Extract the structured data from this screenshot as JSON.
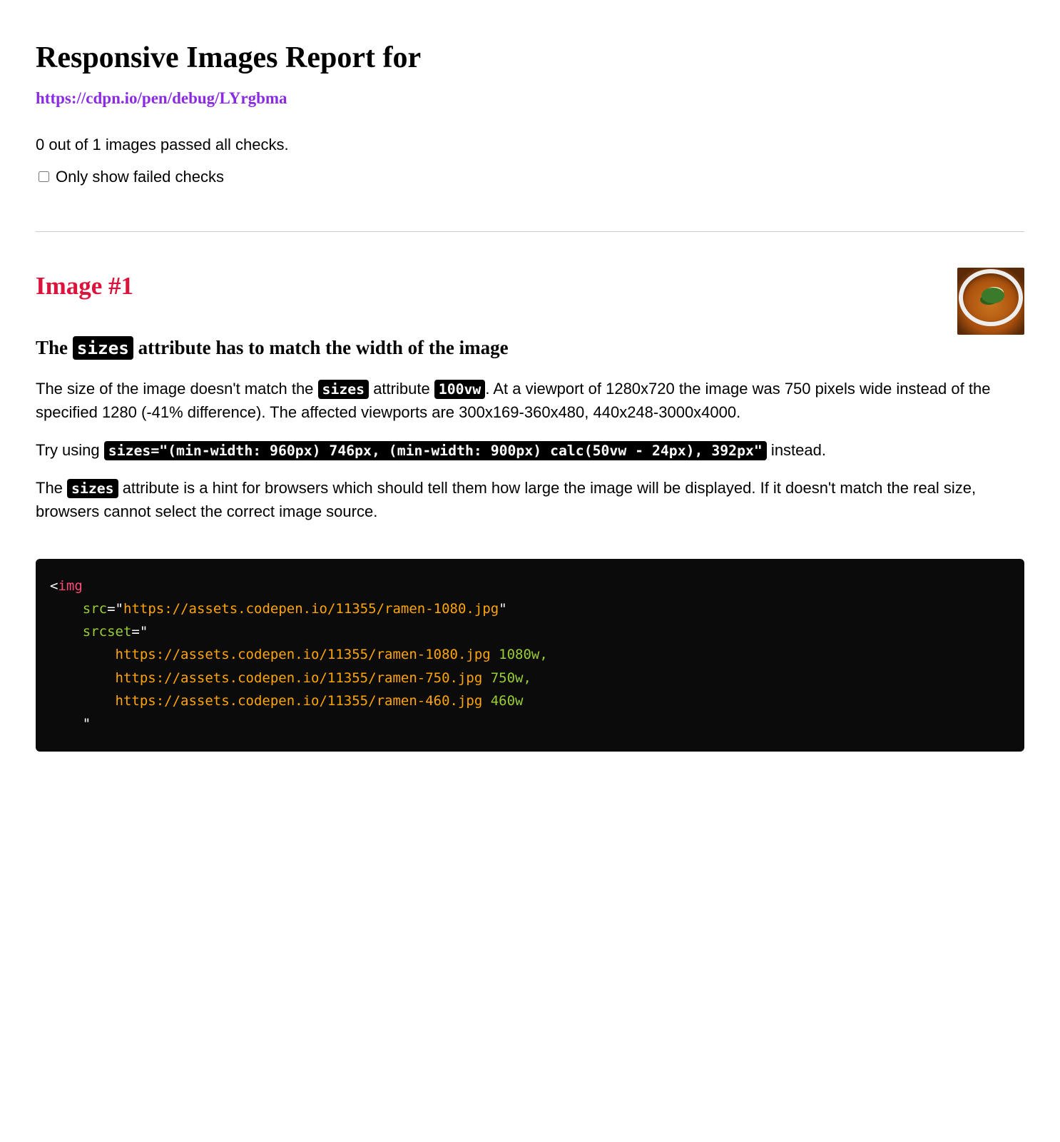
{
  "header": {
    "title": "Responsive Images Report for",
    "url": "https://cdpn.io/pen/debug/LYrgbma"
  },
  "summary": {
    "text": "0 out of 1 images passed all checks.",
    "filter_label": "Only show failed checks"
  },
  "image": {
    "heading": "Image #1",
    "check_heading_pre": "The ",
    "check_heading_code": "sizes",
    "check_heading_post": " attribute has to match the width of the image",
    "para1_a": "The size of the image doesn't match the ",
    "para1_code1": "sizes",
    "para1_b": " attribute ",
    "para1_code2": "100vw",
    "para1_c": ". At a viewport of 1280x720 the image was 750 pixels wide instead of the specified 1280 (-41% difference). The affected viewports are 300x169-360x480, 440x248-3000x4000.",
    "para2_a": "Try using ",
    "para2_code": "sizes=\"(min-width: 960px) 746px, (min-width: 900px) calc(50vw - 24px), 392px\"",
    "para2_b": " instead.",
    "para3_a": "The ",
    "para3_code": "sizes",
    "para3_b": " attribute is a hint for browsers which should tell them how large the image will be displayed. If it doesn't match the real size, browsers cannot select the correct image source."
  },
  "code": {
    "tag_open": "<",
    "tag_name": "img",
    "attr_src_name": "src",
    "eq": "=",
    "q": "\"",
    "src_val": "https://assets.codepen.io/11355/ramen-1080.jpg",
    "attr_srcset_name": "srcset",
    "srcset_line1_url": "https://assets.codepen.io/11355/ramen-1080.jpg",
    "srcset_line1_w": " 1080w,",
    "srcset_line2_url": "https://assets.codepen.io/11355/ramen-750.jpg",
    "srcset_line2_w": " 750w,",
    "srcset_line3_url": "https://assets.codepen.io/11355/ramen-460.jpg",
    "srcset_line3_w": " 460w"
  }
}
